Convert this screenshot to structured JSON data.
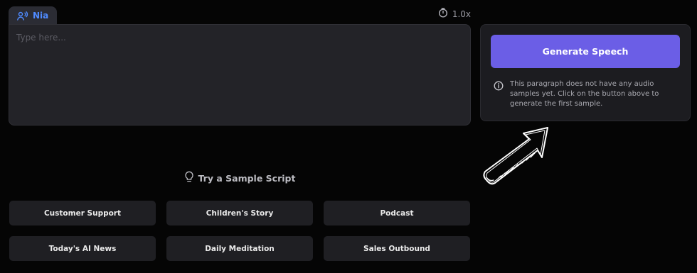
{
  "voice": {
    "name": "Nia",
    "icon": "voice-person-icon",
    "accent": "#4f8bff"
  },
  "speed": {
    "label": "1.0x",
    "icon": "timer-icon"
  },
  "editor": {
    "placeholder": "Type here..."
  },
  "panel": {
    "generate_label": "Generate Speech",
    "button_color": "#6b5ee6",
    "info_icon": "info-icon",
    "info_text": "This paragraph does not have any audio samples yet. Click on the button above to generate the first sample."
  },
  "samples": {
    "heading": "Try a Sample Script",
    "icon": "lightbulb-icon",
    "items": [
      {
        "label": "Customer Support"
      },
      {
        "label": "Children's Story"
      },
      {
        "label": "Podcast"
      },
      {
        "label": "Today's AI News"
      },
      {
        "label": "Daily Meditation"
      },
      {
        "label": "Sales Outbound"
      }
    ]
  }
}
